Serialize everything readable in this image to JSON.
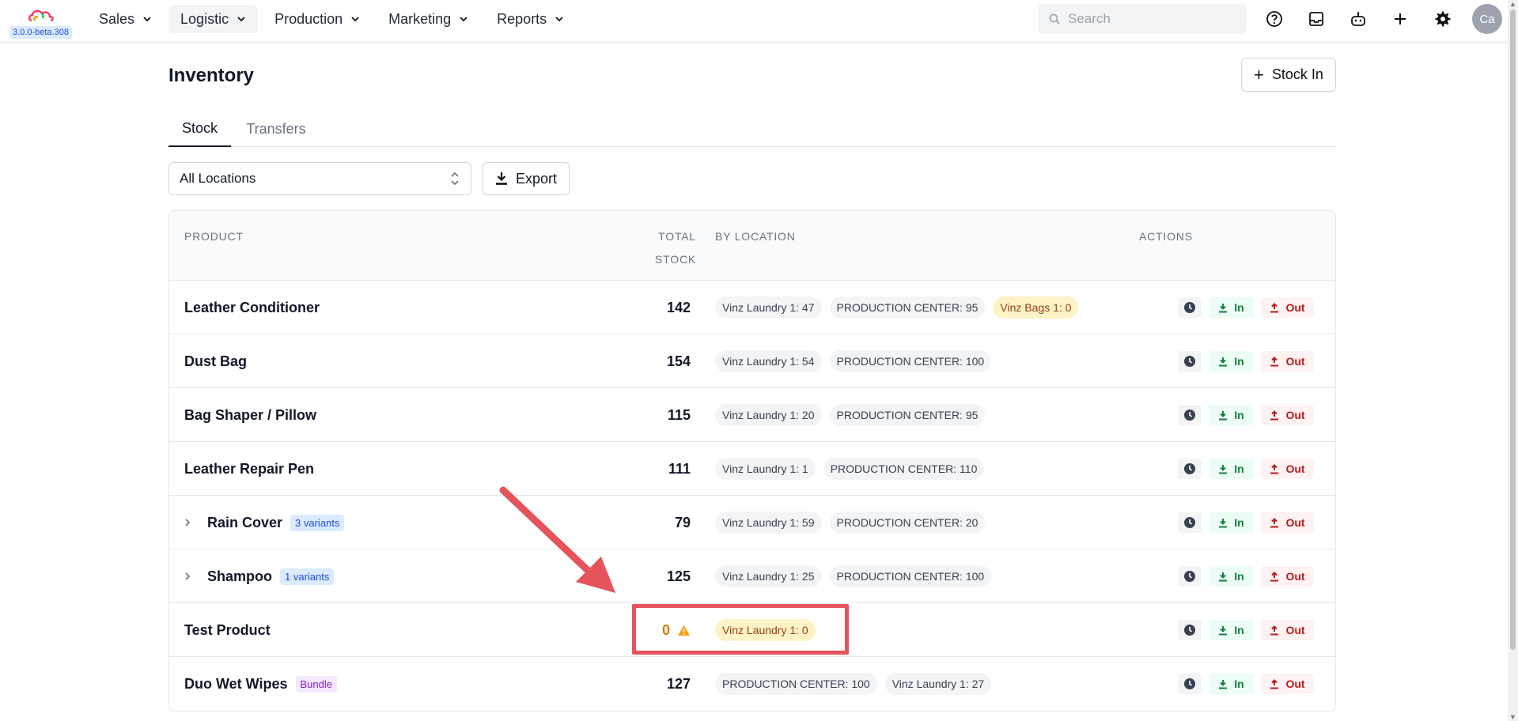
{
  "app": {
    "version": "3.0.0-beta.308"
  },
  "nav": {
    "items": [
      {
        "label": "Sales",
        "active": false
      },
      {
        "label": "Logistic",
        "active": true
      },
      {
        "label": "Production",
        "active": false
      },
      {
        "label": "Marketing",
        "active": false
      },
      {
        "label": "Reports",
        "active": false
      }
    ],
    "search_placeholder": "Search",
    "icons": [
      "help-icon",
      "inbox-icon",
      "bot-icon",
      "plus-icon",
      "gear-icon"
    ],
    "avatar_initials": "Ca"
  },
  "page": {
    "title": "Inventory",
    "stock_in_label": "Stock In",
    "tabs": [
      {
        "label": "Stock",
        "active": true
      },
      {
        "label": "Transfers",
        "active": false
      }
    ],
    "location_filter": "All Locations",
    "export_label": "Export"
  },
  "table": {
    "headers": {
      "product": "PRODUCT",
      "total_line1": "TOTAL",
      "total_line2": "STOCK",
      "by_location": "BY LOCATION",
      "actions": "ACTIONS"
    },
    "action_labels": {
      "in": "In",
      "out": "Out"
    },
    "rows": [
      {
        "product": "Leather Conditioner",
        "total": "142",
        "locations": [
          "Vinz Laundry 1: 47",
          "PRODUCTION CENTER: 95",
          "Vinz Bags 1: 0"
        ]
      },
      {
        "product": "Dust Bag",
        "total": "154",
        "locations": [
          "Vinz Laundry 1: 54",
          "PRODUCTION CENTER: 100"
        ]
      },
      {
        "product": "Bag Shaper / Pillow",
        "total": "115",
        "locations": [
          "Vinz Laundry 1: 20",
          "PRODUCTION CENTER: 95"
        ]
      },
      {
        "product": "Leather Repair Pen",
        "total": "111",
        "locations": [
          "Vinz Laundry 1: 1",
          "PRODUCTION CENTER: 110"
        ]
      },
      {
        "product": "Rain Cover",
        "badge": "3 variants",
        "total": "79",
        "locations": [
          "Vinz Laundry 1: 59",
          "PRODUCTION CENTER: 20"
        ]
      },
      {
        "product": "Shampoo",
        "badge": "1 variants",
        "total": "125",
        "locations": [
          "Vinz Laundry 1: 25",
          "PRODUCTION CENTER: 100"
        ]
      },
      {
        "product": "Test Product",
        "total": "0",
        "locations": [
          "Vinz Laundry 1: 0"
        ]
      },
      {
        "product": "Duo Wet Wipes",
        "badge": "Bundle",
        "total": "127",
        "locations": [
          "PRODUCTION CENTER: 100",
          "Vinz Laundry 1: 27"
        ]
      }
    ]
  },
  "colors": {
    "warning": "#d97706",
    "in_green": "#15803d",
    "out_red": "#b91c1c",
    "annotation_red": "#e5545b"
  }
}
